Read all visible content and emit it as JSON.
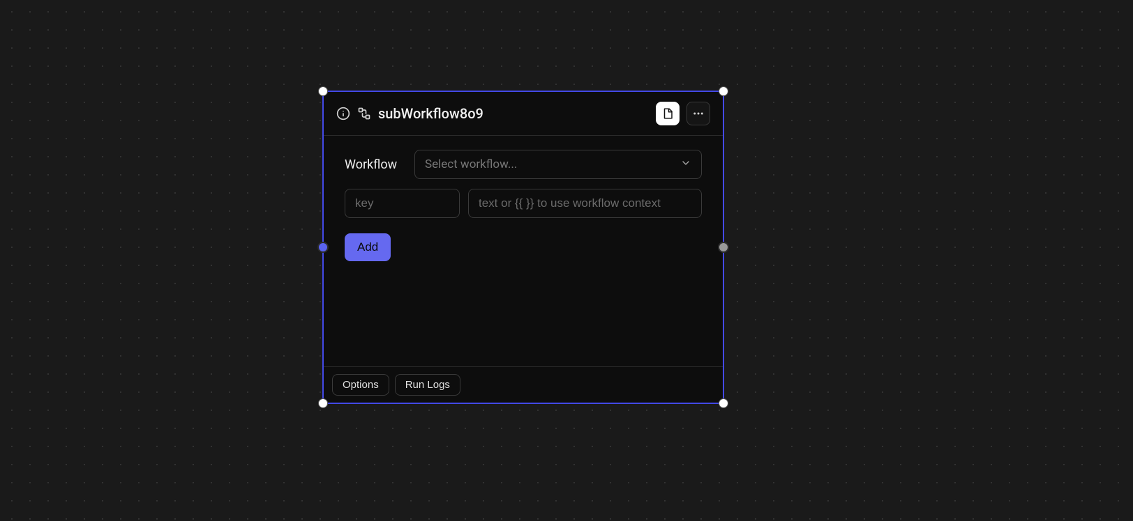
{
  "node": {
    "title": "subWorkflow8o9",
    "workflow_label": "Workflow",
    "workflow_select_placeholder": "Select workflow...",
    "key_placeholder": "key",
    "value_placeholder": "text or {{ }} to use workflow context",
    "add_label": "Add",
    "footer": {
      "options_label": "Options",
      "runlogs_label": "Run Logs"
    }
  }
}
